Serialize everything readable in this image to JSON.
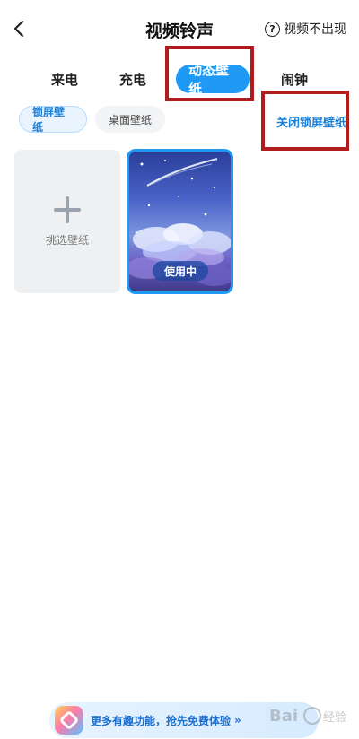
{
  "header": {
    "title": "视频铃声",
    "help_label": "视频不出现",
    "help_icon_glyph": "?"
  },
  "tabs": [
    {
      "label": "来电",
      "active": false
    },
    {
      "label": "充电",
      "active": false
    },
    {
      "label": "动态壁纸",
      "active": true
    },
    {
      "label": "闹钟",
      "active": false
    }
  ],
  "subtabs": {
    "lock_screen": "锁屏壁纸",
    "desktop": "桌面壁纸",
    "active": "锁屏壁纸"
  },
  "close_lock_label": "关闭锁屏壁纸",
  "add_card": {
    "label": "挑选壁纸"
  },
  "wallpaper_card": {
    "badge": "使用中"
  },
  "promo": {
    "text": "更多有趣功能，抢先免费体验",
    "arrow": "»"
  },
  "watermark": {
    "text": "Baidu 经验"
  },
  "colors": {
    "accent": "#1e9af5",
    "highlight": "#b11d1d",
    "link": "#1a7fd6"
  }
}
